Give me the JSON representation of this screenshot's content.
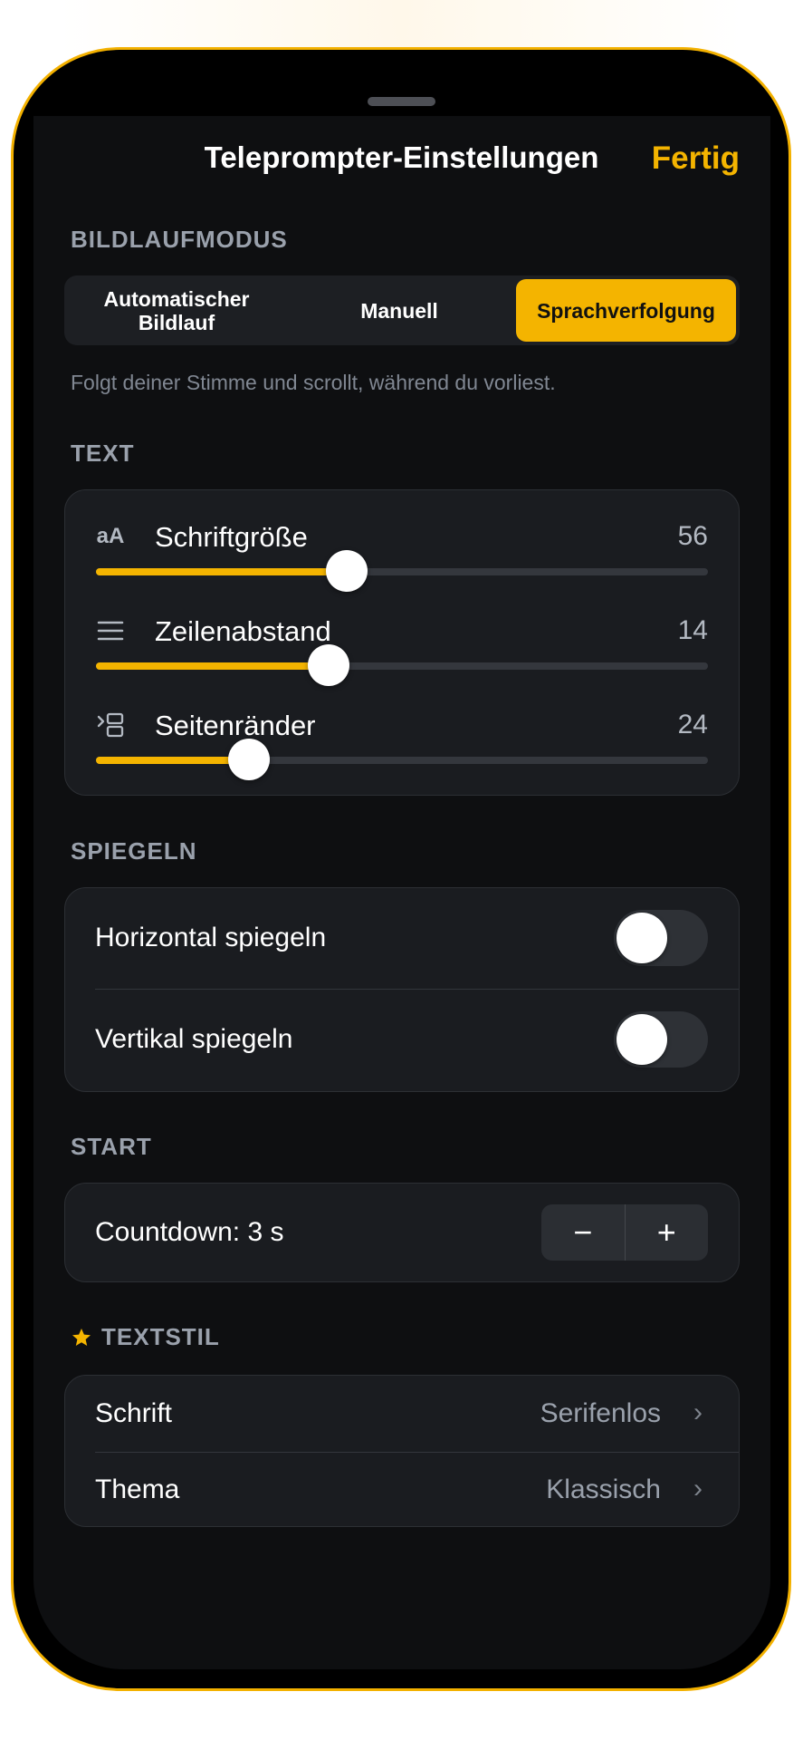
{
  "header": {
    "title": "Teleprompter-Einstellungen",
    "done_label": "Fertig"
  },
  "scroll_mode": {
    "section_label": "BILDLAUFMODUS",
    "options": [
      {
        "line1": "Automatischer",
        "line2": "Bildlauf"
      },
      {
        "line1": "Manuell"
      },
      {
        "line1": "Sprachverfolgung"
      }
    ],
    "selected": "Sprachverfolgung",
    "hint": "Folgt deiner Stimme und scrollt, während du vorliest."
  },
  "text": {
    "section_label": "TEXT",
    "sliders": [
      {
        "icon": "text-size-icon",
        "icon_text": "aA",
        "label": "Schriftgröße",
        "value": "56",
        "fill_fraction": 0.41
      },
      {
        "icon": "line-spacing-icon",
        "label": "Zeilenabstand",
        "value": "14",
        "fill_fraction": 0.38
      },
      {
        "icon": "margins-icon",
        "label": "Seitenränder",
        "value": "24",
        "fill_fraction": 0.25
      }
    ]
  },
  "mirror": {
    "section_label": "SPIEGELN",
    "horizontal_label": "Horizontal spiegeln",
    "vertical_label": "Vertikal spiegeln",
    "horizontal_on": false,
    "vertical_on": false
  },
  "start": {
    "section_label": "START",
    "countdown_label": "Countdown: 3 s",
    "minus": "−",
    "plus": "+"
  },
  "textstyle": {
    "section_label": "TEXTSTIL",
    "font_label": "Schrift",
    "font_value": "Serifenlos",
    "theme_label": "Thema",
    "theme_value": "Klassisch"
  },
  "colors": {
    "accent": "#f4b400",
    "background": "#0e0f11",
    "card": "#1a1c20"
  }
}
